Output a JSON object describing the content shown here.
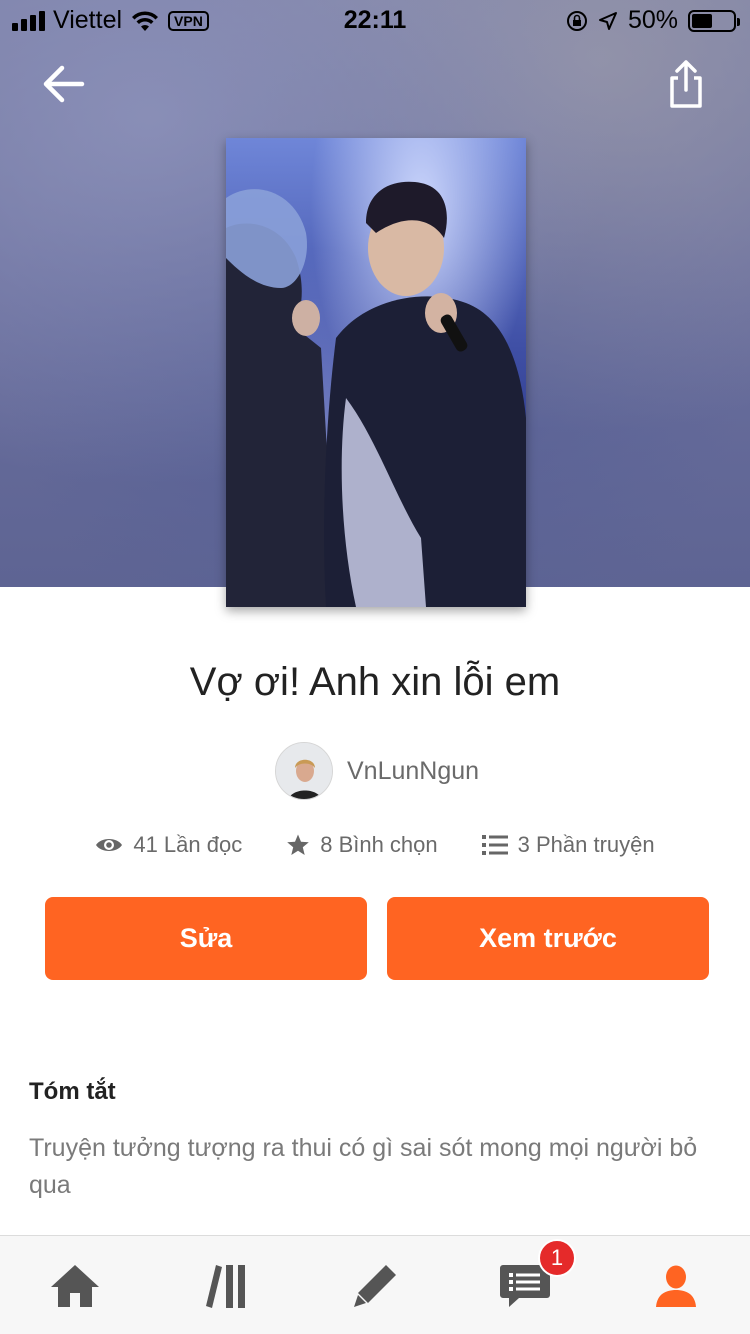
{
  "status_bar": {
    "carrier": "Viettel",
    "vpn": "VPN",
    "time": "22:11",
    "battery_percent": "50%",
    "battery_level": 0.5
  },
  "story": {
    "title": "Vợ ơi! Anh xin lỗi em",
    "author": "VnLunNgun"
  },
  "stats": {
    "reads": "41 Lần đọc",
    "votes": "8 Bình chọn",
    "parts": "3 Phần truyện"
  },
  "actions": {
    "edit_label": "Sửa",
    "preview_label": "Xem trước"
  },
  "summary": {
    "heading": "Tóm tắt",
    "text": "Truyện tưởng tượng ra thui có gì sai sót mong mọi người bỏ qua"
  },
  "tabbar": {
    "icons": [
      "home-icon",
      "library-icon",
      "write-icon",
      "messages-icon",
      "profile-icon"
    ],
    "notification_badge": "1"
  },
  "colors": {
    "accent": "#ff6422",
    "badge": "#e52a2a",
    "active_tab": "#ff6422",
    "inactive_tab": "#555555"
  }
}
